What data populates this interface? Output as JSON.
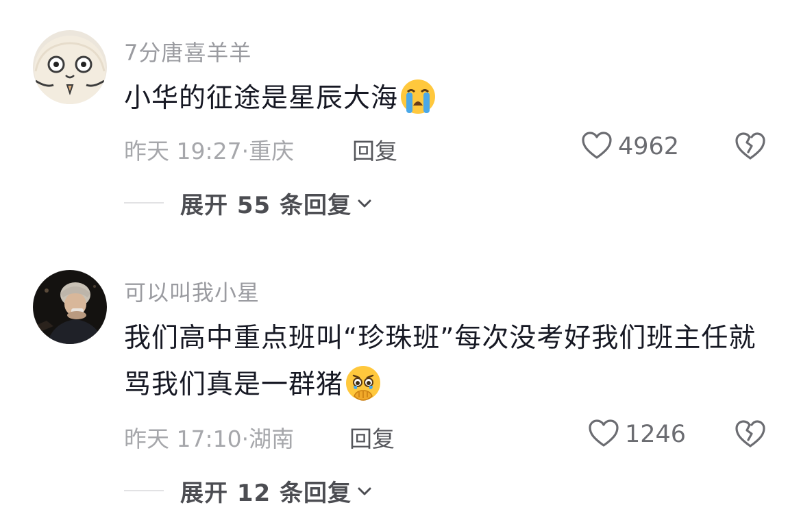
{
  "comments": [
    {
      "username": "7分唐喜羊羊",
      "text": "小华的征途是星辰大海",
      "emoji": "loudly-crying-face",
      "timestamp": "昨天 19:27",
      "separator": "·",
      "location": "重庆",
      "reply_label": "回复",
      "likes": "4962",
      "expand_label": "展开 55 条回复",
      "avatar": "cartoon-face-avatar"
    },
    {
      "username": "可以叫我小星",
      "text": "我们高中重点班叫“珍珠班”每次没考好我们班主任就骂我们真是一群猪",
      "emoji": "face-holding-back-tears",
      "timestamp": "昨天 17:10",
      "separator": "·",
      "location": "湖南",
      "reply_label": "回复",
      "likes": "1246",
      "expand_label": "展开 12 条回复",
      "avatar": "photo-avatar"
    }
  ],
  "colors": {
    "text_primary": "#161823",
    "text_secondary": "#9a9ba0",
    "reply": "#55565b",
    "emoji_yellow": "#ffc83d",
    "tear_blue": "#4aa8e8"
  }
}
